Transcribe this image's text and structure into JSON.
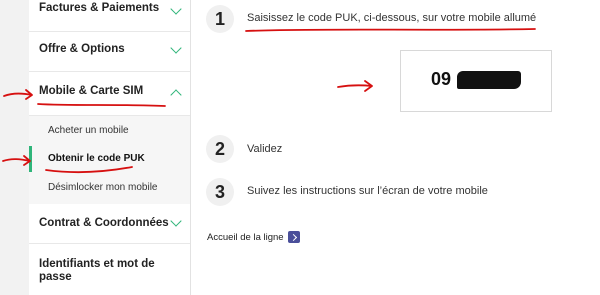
{
  "sidebar": {
    "items": [
      {
        "label": "Factures & Paiements",
        "expanded": false
      },
      {
        "label": "Offre & Options",
        "expanded": false
      },
      {
        "label": "Mobile & Carte SIM",
        "expanded": true
      },
      {
        "label": "Contrat & Coordonnées",
        "expanded": false
      },
      {
        "label": "Identifiants et mot de",
        "label2": "passe",
        "expanded": false
      }
    ],
    "sub_items": [
      {
        "label": "Acheter un mobile",
        "active": false
      },
      {
        "label": "Obtenir le code PUK",
        "active": true
      },
      {
        "label": "Désimlocker mon mobile",
        "active": false
      }
    ]
  },
  "steps": [
    {
      "number": "1",
      "text": "Saisissez le code PUK, ci-dessous, sur votre mobile allumé"
    },
    {
      "number": "2",
      "text": "Validez"
    },
    {
      "number": "3",
      "text": "Suivez les instructions sur l’écran de votre mobile"
    }
  ],
  "puk": {
    "visible_prefix": "09"
  },
  "footer_link": {
    "label": "Accueil de la ligne",
    "icon": "chevron-right-icon"
  },
  "colors": {
    "accent": "#2fb57a",
    "annotation": "#d61010",
    "link_button": "#4a4f9a"
  }
}
